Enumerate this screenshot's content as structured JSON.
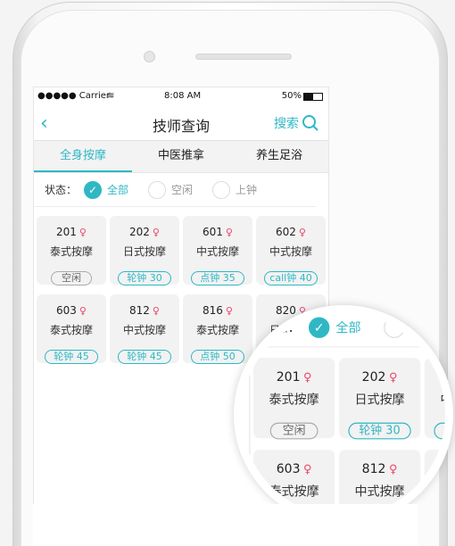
{
  "status_bar": {
    "carrier": "●●●●● Carrier",
    "time": "8:08 AM",
    "battery": "50%"
  },
  "header": {
    "title": "技师查询",
    "search_label": "搜索"
  },
  "tabs": [
    {
      "label": "全身按摩",
      "active": true
    },
    {
      "label": "中医推拿"
    },
    {
      "label": "养生足浴"
    }
  ],
  "filter": {
    "label": "状态：",
    "options": [
      {
        "label": "全部",
        "selected": true
      },
      {
        "label": "空闲"
      },
      {
        "label": "上钟"
      }
    ]
  },
  "technicians": [
    {
      "number": "201",
      "type": "泰式按摩",
      "status": "空闲",
      "idle": true
    },
    {
      "number": "202",
      "type": "日式按摩",
      "status": "轮钟  30"
    },
    {
      "number": "601",
      "type": "中式按摩",
      "status": "点钟  35"
    },
    {
      "number": "602",
      "type": "中式按摩",
      "status": "call钟  40"
    },
    {
      "number": "603",
      "type": "泰式按摩",
      "status": "轮钟  45"
    },
    {
      "number": "812",
      "type": "中式按摩",
      "status": "轮钟  45"
    },
    {
      "number": "816",
      "type": "泰式按摩",
      "status": "点钟  50"
    },
    {
      "number": "820",
      "type": "日式按摩",
      "status": ""
    }
  ],
  "colors": {
    "accent": "#2fb8c4",
    "female": "#e8466a"
  }
}
